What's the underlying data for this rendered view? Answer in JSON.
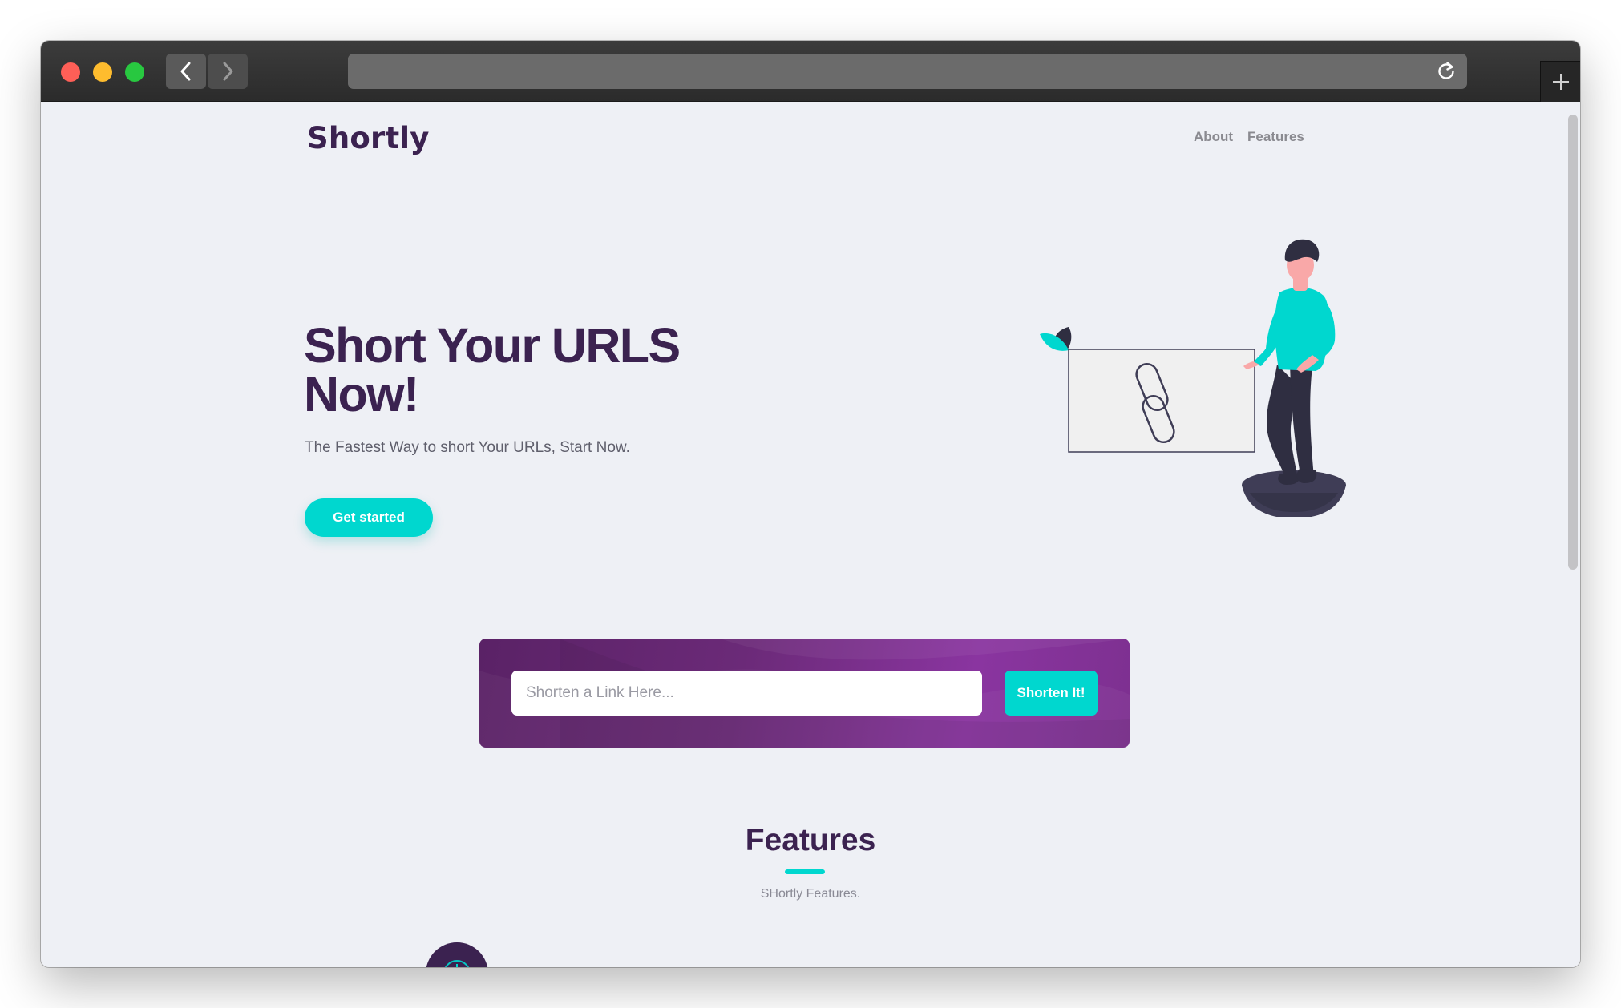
{
  "browser": {
    "url": "",
    "icons": {
      "close": "close-traffic-light",
      "minimize": "minimize-traffic-light",
      "maximize": "maximize-traffic-light",
      "back": "chevron-left-icon",
      "forward": "chevron-right-icon",
      "reload": "reload-icon",
      "new_tab": "plus-icon"
    }
  },
  "site": {
    "logo": "Shortly",
    "nav": [
      {
        "label": "About"
      },
      {
        "label": "Features"
      }
    ]
  },
  "hero": {
    "title": "Short Your URLS Now!",
    "subtitle": "The Fastest Way to short Your URLs, Start Now.",
    "cta_label": "Get started",
    "illustration": "person-with-link-illustration"
  },
  "shorten": {
    "placeholder": "Shorten a Link Here...",
    "value": "",
    "button_label": "Shorten It!"
  },
  "features": {
    "title": "Features",
    "subtitle": "SHortly Features."
  },
  "colors": {
    "brand_dark": "#3b2250",
    "accent_cyan": "#00d7cf",
    "panel_purple": "#6b2a78",
    "page_bg": "#eef0f5"
  }
}
